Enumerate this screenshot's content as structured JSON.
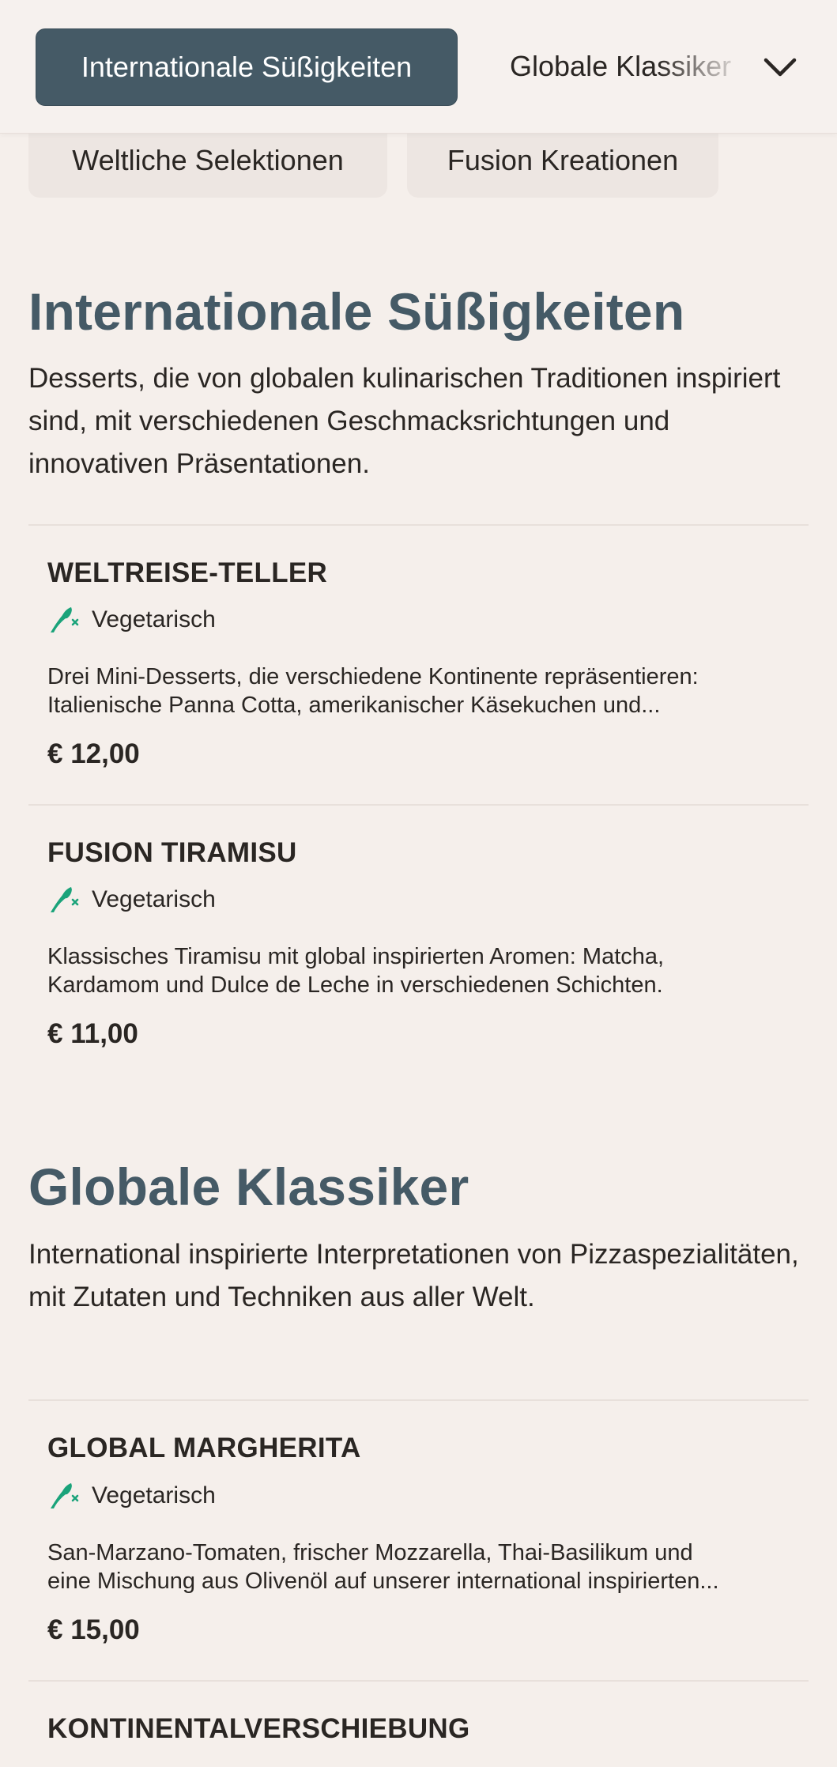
{
  "nav": {
    "active_tab": "Internationale Süßigkeiten",
    "next_tab": "Globale Klassiker",
    "chips": [
      "Weltliche Selektionen",
      "Fusion Kreationen"
    ]
  },
  "colors": {
    "accent": "#455a66",
    "veg_green": "#1aa37a",
    "background": "#f5efeb"
  },
  "sections": [
    {
      "title": "Internationale Süßigkeiten",
      "description": "Desserts, die von globalen kulinarischen Traditionen inspiriert sind, mit verschiedenen Geschmacksrichtungen und innovativen Präsentationen.",
      "items": [
        {
          "name": "WELTREISE-TELLER",
          "tag": "Vegetarisch",
          "desc_line1": "Drei Mini-Desserts, die verschiedene Kontinente repräsentieren:",
          "desc_line2": "Italienische Panna Cotta, amerikanischer Käsekuchen und...",
          "price": "€ 12,00"
        },
        {
          "name": "FUSION TIRAMISU",
          "tag": "Vegetarisch",
          "desc_line1": "Klassisches Tiramisu mit global inspirierten Aromen: Matcha,",
          "desc_line2": "Kardamom und Dulce de Leche in verschiedenen Schichten.",
          "price": "€ 11,00"
        }
      ]
    },
    {
      "title": "Globale Klassiker",
      "description": "International inspirierte Interpretationen von Pizzaspezialitäten, mit Zutaten und Techniken aus aller Welt.",
      "items": [
        {
          "name": "GLOBAL MARGHERITA",
          "tag": "Vegetarisch",
          "desc_line1": "San-Marzano-Tomaten, frischer Mozzarella, Thai-Basilikum und",
          "desc_line2": "eine Mischung aus Olivenöl auf unserer international inspirierten...",
          "price": "€ 15,00"
        },
        {
          "name": "KONTINENTALVERSCHIEBUNG"
        }
      ]
    }
  ],
  "icons": {
    "tab_expand": "chevron-down-icon",
    "vegetarian": "vegetarian-icon"
  }
}
